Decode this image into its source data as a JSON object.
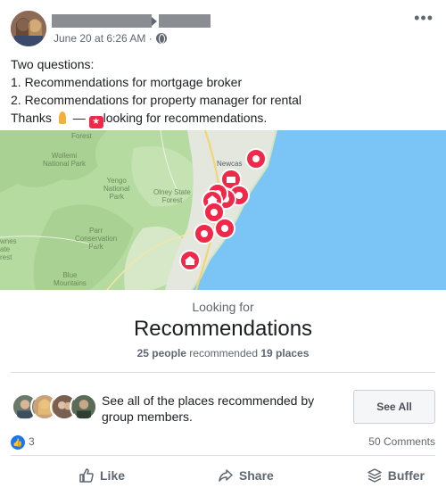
{
  "post": {
    "meta": "June 20 at 6:26 AM ·",
    "more": "•••",
    "lines": [
      "Two questions:",
      "1. Recommendations for mortgage broker",
      "2. Recommendations for property manager for rental"
    ],
    "thanks_prefix": "Thanks",
    "thanks_dash": "—",
    "thanks_suffix": "looking for recommendations."
  },
  "map": {
    "labels": {
      "wollemi": "Wollemi\nNational Park",
      "yengo": "Yengo\nNational\nPark",
      "olney": "Olney State\nForest",
      "parr": "Parr\nConservation\nPark",
      "blue": "Blue\nMountains",
      "newcastle": "Newcas",
      "forest_top": "Forest",
      "wnes": "wnes\nate\nrest"
    }
  },
  "recommendations": {
    "looking_for": "Looking for",
    "title": "Recommendations",
    "people_count": "25 people",
    "recommended_word": "recommended",
    "places_count": "19 places"
  },
  "see_all": {
    "description": "See all of the places recommended by group members.",
    "button_label": "See All"
  },
  "reactions": {
    "like_count": "3",
    "comments": "50 Comments"
  },
  "actions": {
    "like": "Like",
    "share": "Share",
    "buffer": "Buffer"
  },
  "colors": {
    "accent_blue": "#1877f2",
    "pin_red": "#f02849",
    "water": "#7ac5f5",
    "land_green": "#b6dba1"
  }
}
